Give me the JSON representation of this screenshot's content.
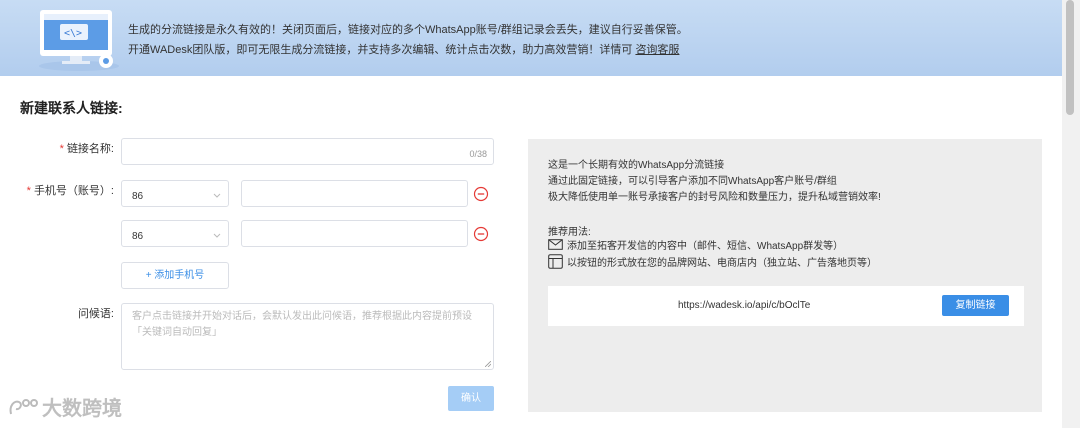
{
  "banner": {
    "line1": "生成的分流链接是永久有效的！关闭页面后，链接对应的多个WhatsApp账号/群组记录会丢失，建议自行妥善保管。",
    "line2_prefix": "开通WADesk团队版，即可无限生成分流链接，并支持多次编辑、统计点击次数，助力高效营销！详情可",
    "line2_link": "咨询客服"
  },
  "page_title": "新建联系人链接:",
  "form": {
    "name_label": "链接名称:",
    "name_value": "",
    "name_counter": "0/38",
    "phone_label": "手机号（账号）:",
    "phones": [
      {
        "country_code": "86",
        "number": ""
      },
      {
        "country_code": "86",
        "number": ""
      }
    ],
    "add_phone_label": "+ 添加手机号",
    "greeting_label": "问候语:",
    "greeting_placeholder": "客户点击链接并开始对话后，会默认发出此问候语，推荐根据此内容提前预设「关键词自动回复」",
    "confirm_label": "确认"
  },
  "info": {
    "line1": "这是一个长期有效的WhatsApp分流链接",
    "line2": "通过此固定链接，可以引导客户添加不同WhatsApp客户账号/群组",
    "line3": "极大降低使用单一账号承接客户的封号风险和数量压力，提升私域营销效率!",
    "rec_title": "推荐用法:",
    "rec1": "添加至拓客开发信的内容中（邮件、短信、WhatsApp群发等）",
    "rec2": "以按钮的形式放在您的品牌网站、电商店内（独立站、广告落地页等）",
    "url": "https://wadesk.io/api/c/bOclTe",
    "copy_label": "复制链接"
  },
  "watermark": "大数跨境",
  "colors": {
    "accent": "#3a8ee6",
    "required": "#e53935",
    "banner_bg": "#c7dcf4",
    "confirm_disabled": "#a5cdf6"
  }
}
